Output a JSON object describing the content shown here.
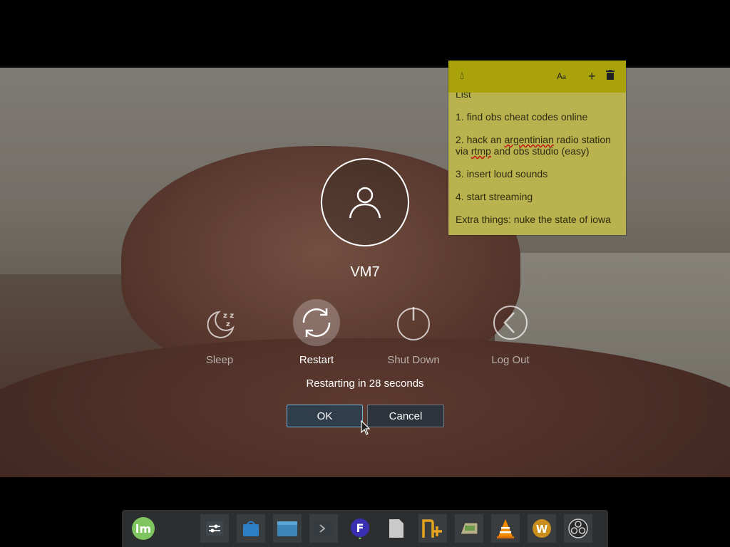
{
  "note": {
    "partial_line": "List",
    "items": [
      {
        "before": "1. find obs cheat codes online"
      },
      {
        "before": "2. hack an ",
        "misspelled": "argentinian",
        "middle": " radio station via ",
        "misspelled2": "rtmp",
        "after": " and obs studio (easy)"
      },
      {
        "before": "3. insert loud sounds"
      },
      {
        "before": "4. start streaming"
      },
      {
        "before": "Extra things: nuke the state of iowa"
      }
    ]
  },
  "dialog": {
    "username": "VM7",
    "actions": [
      {
        "label": "Sleep",
        "icon": "moon-zzz-icon",
        "selected": false
      },
      {
        "label": "Restart",
        "icon": "restart-icon",
        "selected": true
      },
      {
        "label": "Shut Down",
        "icon": "power-icon",
        "selected": false
      },
      {
        "label": "Log Out",
        "icon": "chevron-left-icon",
        "selected": false
      }
    ],
    "countdown": "Restarting in 28 seconds",
    "ok_label": "OK",
    "cancel_label": "Cancel"
  },
  "taskbar": {
    "items": [
      {
        "name": "mint-menu-icon"
      },
      {
        "name": "system-settings-icon"
      },
      {
        "name": "software-store-icon"
      },
      {
        "name": "file-manager-icon"
      },
      {
        "name": "terminal-icon"
      },
      {
        "name": "app-f-icon"
      },
      {
        "name": "text-file-icon"
      },
      {
        "name": "sticky-notes-icon"
      },
      {
        "name": "drive-icon"
      },
      {
        "name": "vlc-icon"
      },
      {
        "name": "winamp-icon"
      },
      {
        "name": "obs-icon"
      }
    ]
  },
  "colors": {
    "note_bg": "#b9b24f",
    "note_bar": "#a9a20b",
    "ok_border": "#7cb0d0"
  }
}
